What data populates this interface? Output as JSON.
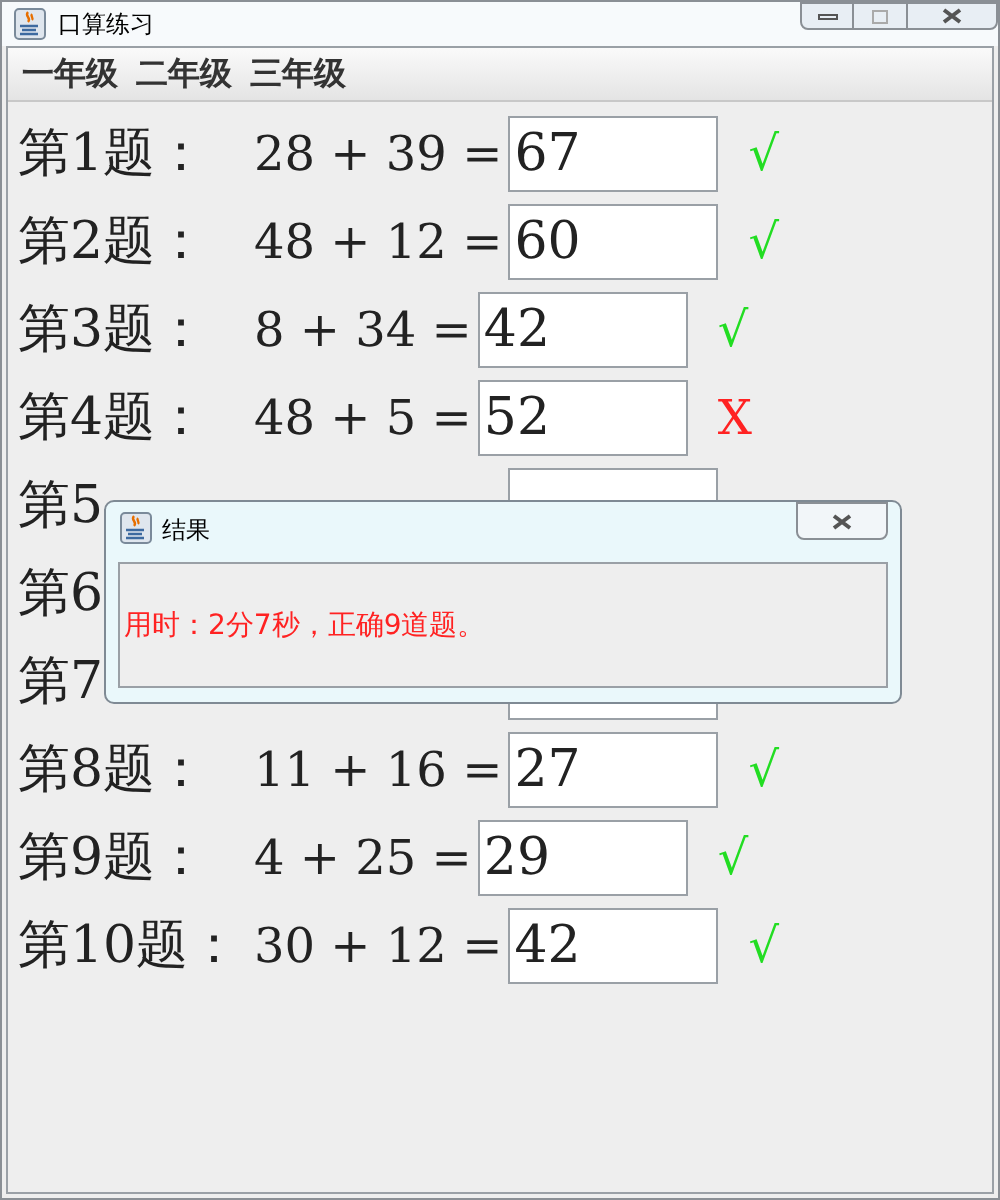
{
  "window": {
    "title": "口算练习"
  },
  "menu": [
    "一年级",
    "二年级",
    "三年级"
  ],
  "rows": [
    {
      "label": "第1题：",
      "equation": "28 + 39 =",
      "answer": "67",
      "correct": true,
      "mark": "√"
    },
    {
      "label": "第2题：",
      "equation": "48 + 12 =",
      "answer": "60",
      "correct": true,
      "mark": "√"
    },
    {
      "label": "第3题：",
      "equation": "8 + 34 =",
      "answer": "42",
      "correct": true,
      "mark": "√"
    },
    {
      "label": "第4题：",
      "equation": "48 + 5 =",
      "answer": "52",
      "correct": false,
      "mark": "X"
    },
    {
      "label": "第5",
      "box": true
    },
    {
      "label": "第6"
    },
    {
      "label": "第7",
      "box": true
    },
    {
      "label": "第8题：",
      "equation": "11 + 16 =",
      "answer": "27",
      "correct": true,
      "mark": "√"
    },
    {
      "label": "第9题：",
      "equation": "4 + 25 =",
      "answer": "29",
      "correct": true,
      "mark": "√"
    },
    {
      "label": "第10题：",
      "equation": "30 + 12 =",
      "answer": "42",
      "correct": true,
      "mark": "√"
    }
  ],
  "dialog": {
    "title": "结果",
    "message": "用时：2分7秒，正确9道题。"
  }
}
